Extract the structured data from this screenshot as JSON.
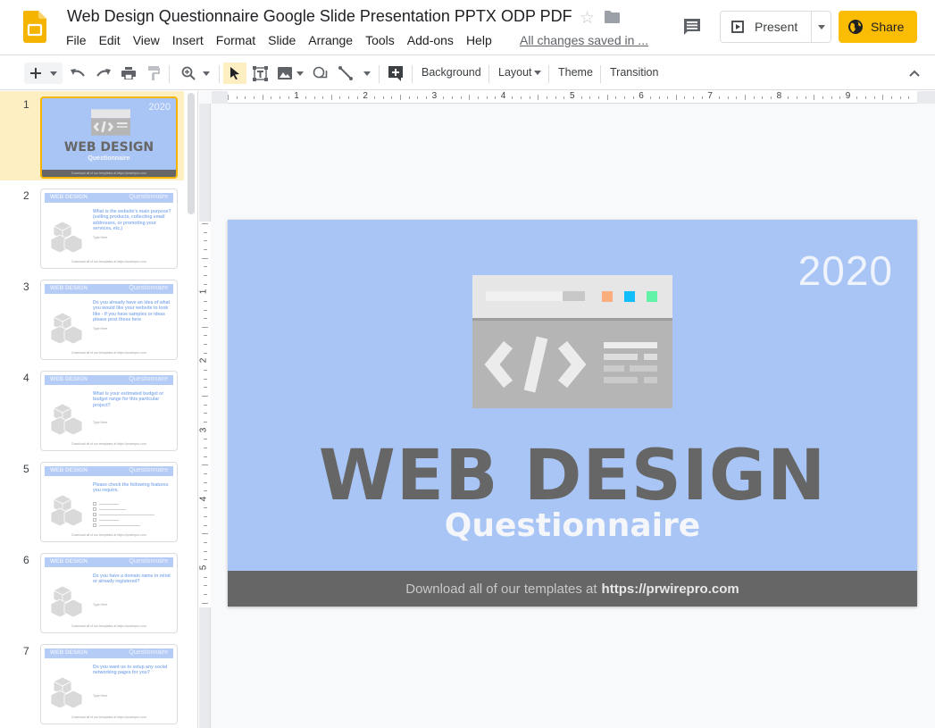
{
  "app": {
    "title": "Web Design Questionnaire Google Slide Presentation PPTX ODP PDF",
    "save_status": "All changes saved in ...",
    "menu": [
      "File",
      "Edit",
      "View",
      "Insert",
      "Format",
      "Slide",
      "Arrange",
      "Tools",
      "Add-ons",
      "Help"
    ],
    "present_label": "Present",
    "share_label": "Share",
    "accent_color": "#fbbc04"
  },
  "toolbar": {
    "icons": [
      "new-slide-icon",
      "undo-icon",
      "redo-icon",
      "print-icon",
      "paint-format-icon",
      "zoom-icon",
      "select-icon",
      "textbox-icon",
      "image-icon",
      "shape-icon",
      "line-icon",
      "comment-add-icon"
    ],
    "background_label": "Background",
    "layout_label": "Layout",
    "theme_label": "Theme",
    "transition_label": "Transition"
  },
  "ruler": {
    "horizontal": [
      "1",
      "2",
      "3",
      "4",
      "5",
      "6",
      "7",
      "8",
      "9"
    ],
    "vertical": [
      "1",
      "2",
      "3",
      "4",
      "5"
    ]
  },
  "filmstrip": {
    "selected": 1,
    "header_left": "WEB DESIGN",
    "header_right": "Questionnaire",
    "type_here": "Type Here",
    "footer": "Download all of our templates at https://prwirepro.com",
    "slides": [
      {
        "num": "1",
        "kind": "title"
      },
      {
        "num": "2",
        "question": "What is the website's main purpose? (selling products, collecting email addresses, or promoting your services, etc.)"
      },
      {
        "num": "3",
        "question": "Do you already have an idea of what you would like your website to look like - if you have samples or ideas please post those here"
      },
      {
        "num": "4",
        "question": "What is your estimated budget or budget range for this particular project?"
      },
      {
        "num": "5",
        "question": "Please check the following features you require."
      },
      {
        "num": "6",
        "question": "Do you have a domain name in mind or already registered?"
      },
      {
        "num": "7",
        "question": "Do you want us to setup any social networking pages for you?"
      }
    ]
  },
  "slide": {
    "year": "2020",
    "title": "WEB DESIGN",
    "subtitle": "Questionnaire",
    "footer_prefix": "Download all of our templates at",
    "footer_link": "https://prwirepro.com",
    "background_color": "#a9c5f5",
    "title_color": "#666666",
    "footer_color": "#666666",
    "window_dots": [
      "#fcae7d",
      "#11bdfa",
      "#62f3a9"
    ]
  }
}
